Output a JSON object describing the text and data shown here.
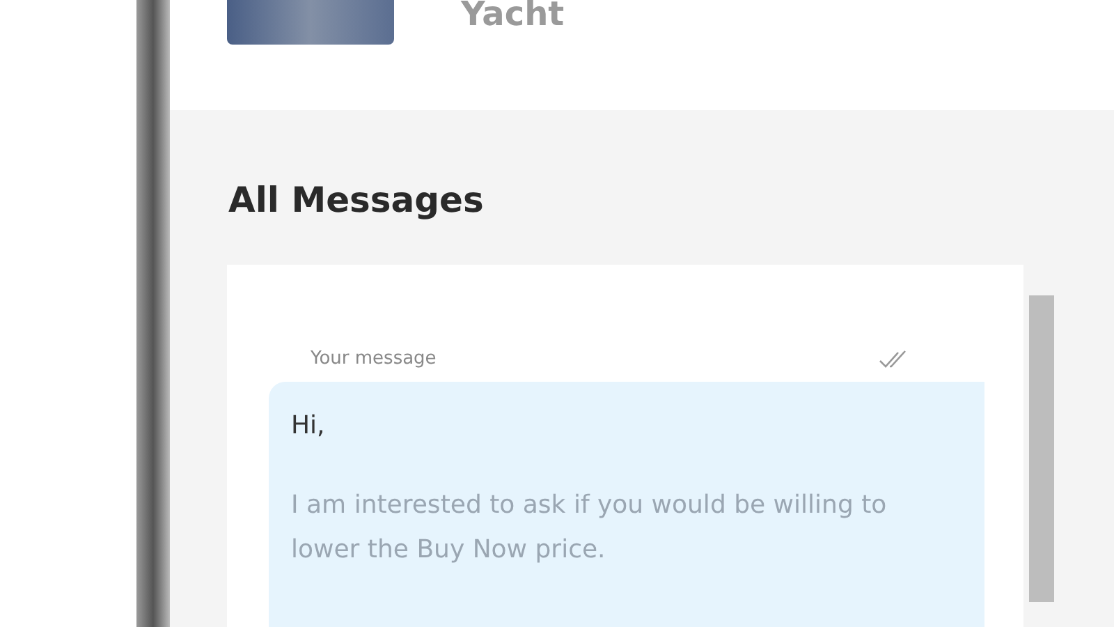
{
  "listing": {
    "title": "Yacht"
  },
  "heading": "All Messages",
  "message": {
    "label": "Your message",
    "read": true,
    "paragraphs": [
      "Hi,",
      "I am interested to ask if you would be willing to lower the Buy Now price."
    ]
  }
}
